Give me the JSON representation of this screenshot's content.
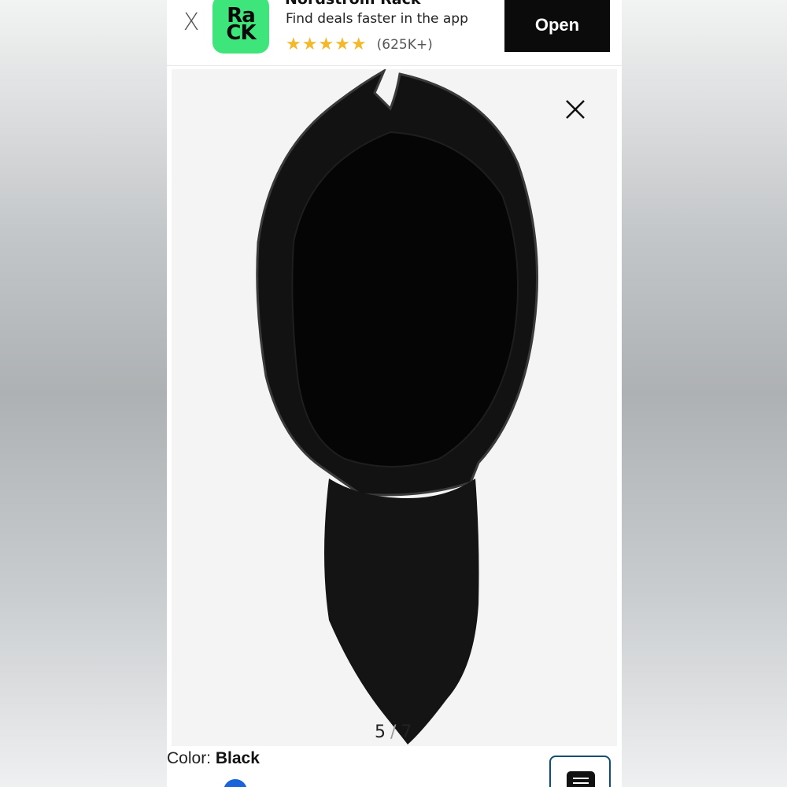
{
  "banner": {
    "close_label": "X",
    "logo_line1": "Ra",
    "logo_line2": "CK",
    "app_name": "Nordstrom Rack",
    "tagline": "Find deals faster in the app",
    "stars": "★★★★★",
    "rating_count": "(625K+)",
    "open_label": "Open",
    "logo_color": "#3de57a",
    "star_color": "#f3b82b"
  },
  "viewer": {
    "current": "5",
    "separator": "/",
    "total": "7",
    "product_image": "black suede pointed-toe boot, top-down view"
  },
  "product": {
    "color_label": "Color:",
    "color_value": "Black",
    "swatch_color": "#1a63d8"
  },
  "icons": {
    "banner_close": "close-icon",
    "viewer_close": "close-icon",
    "menu": "list-icon"
  }
}
